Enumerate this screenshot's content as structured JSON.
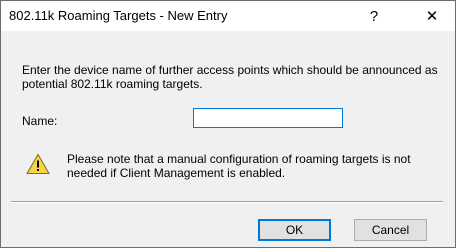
{
  "window": {
    "title": "802.11k Roaming Targets - New Entry",
    "help_glyph": "?",
    "close_glyph": "✕"
  },
  "dialog": {
    "description": "Enter the device name of further access points which should be announced as potential 802.11k roaming targets.",
    "name_label": "Name:",
    "name_value": "",
    "warning_text": "Please note that a manual configuration of roaming targets is not needed if Client Management is enabled."
  },
  "buttons": {
    "ok_label": "OK",
    "cancel_label": "Cancel"
  },
  "colors": {
    "accent": "#0078d7",
    "warning_fill": "#f7d44c"
  },
  "icons": {
    "warning": "warning-triangle-icon"
  }
}
